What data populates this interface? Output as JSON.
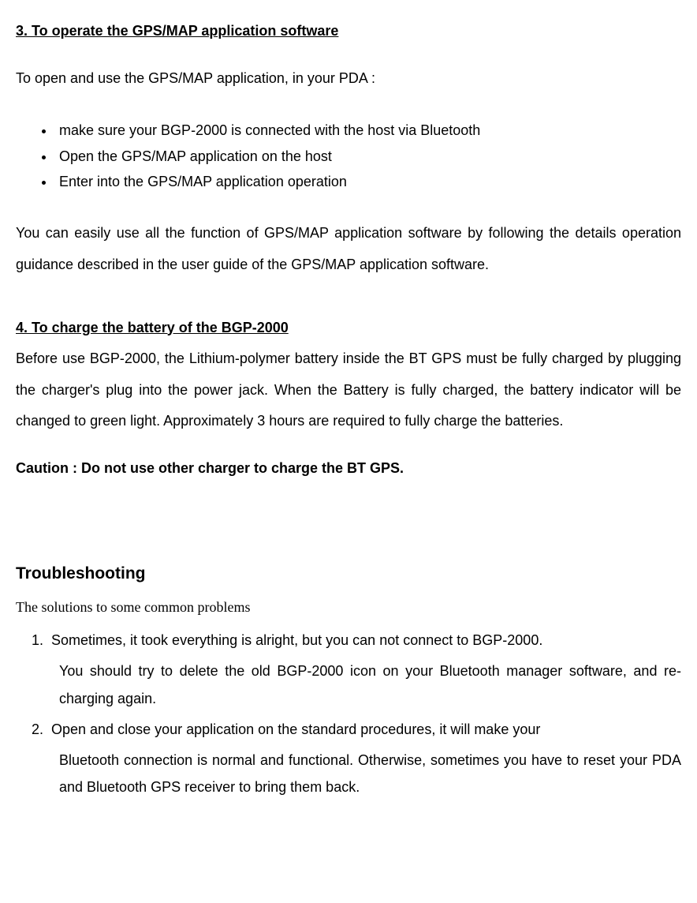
{
  "section3": {
    "heading": "3. To operate the GPS/MAP application software",
    "intro": "To open and use the GPS/MAP application, in your PDA :",
    "bullets": [
      "make sure your BGP-2000 is connected with the host via Bluetooth",
      "Open the GPS/MAP application on the host",
      "Enter into the GPS/MAP application operation"
    ],
    "body": "You can easily use all the function of GPS/MAP application software by following the details operation guidance described in the user guide of the GPS/MAP application software."
  },
  "section4": {
    "heading": "4. To charge the battery of the BGP-2000",
    "body": "Before use BGP-2000, the Lithium-polymer battery inside the BT GPS must be fully charged by plugging the charger's plug into the power jack. When the Battery is fully charged, the battery indicator will be changed to green light. Approximately 3 hours are required to fully charge the batteries.",
    "caution": "Caution : Do not use other charger to charge the BT GPS."
  },
  "troubleshooting": {
    "heading": "Troubleshooting",
    "subheading": "The solutions to some common problems",
    "item1_line1": "Sometimes, it took everything is alright, but you can not connect to BGP-2000.",
    "item1_rest": "You should try to delete the old BGP-2000 icon on your Bluetooth manager software, and re-charging again.",
    "item2_line1": "Open and close your application on the standard procedures, it will make your",
    "item2_rest": "Bluetooth connection is normal and functional. Otherwise, sometimes you have to reset your PDA and Bluetooth GPS receiver to bring them back."
  }
}
